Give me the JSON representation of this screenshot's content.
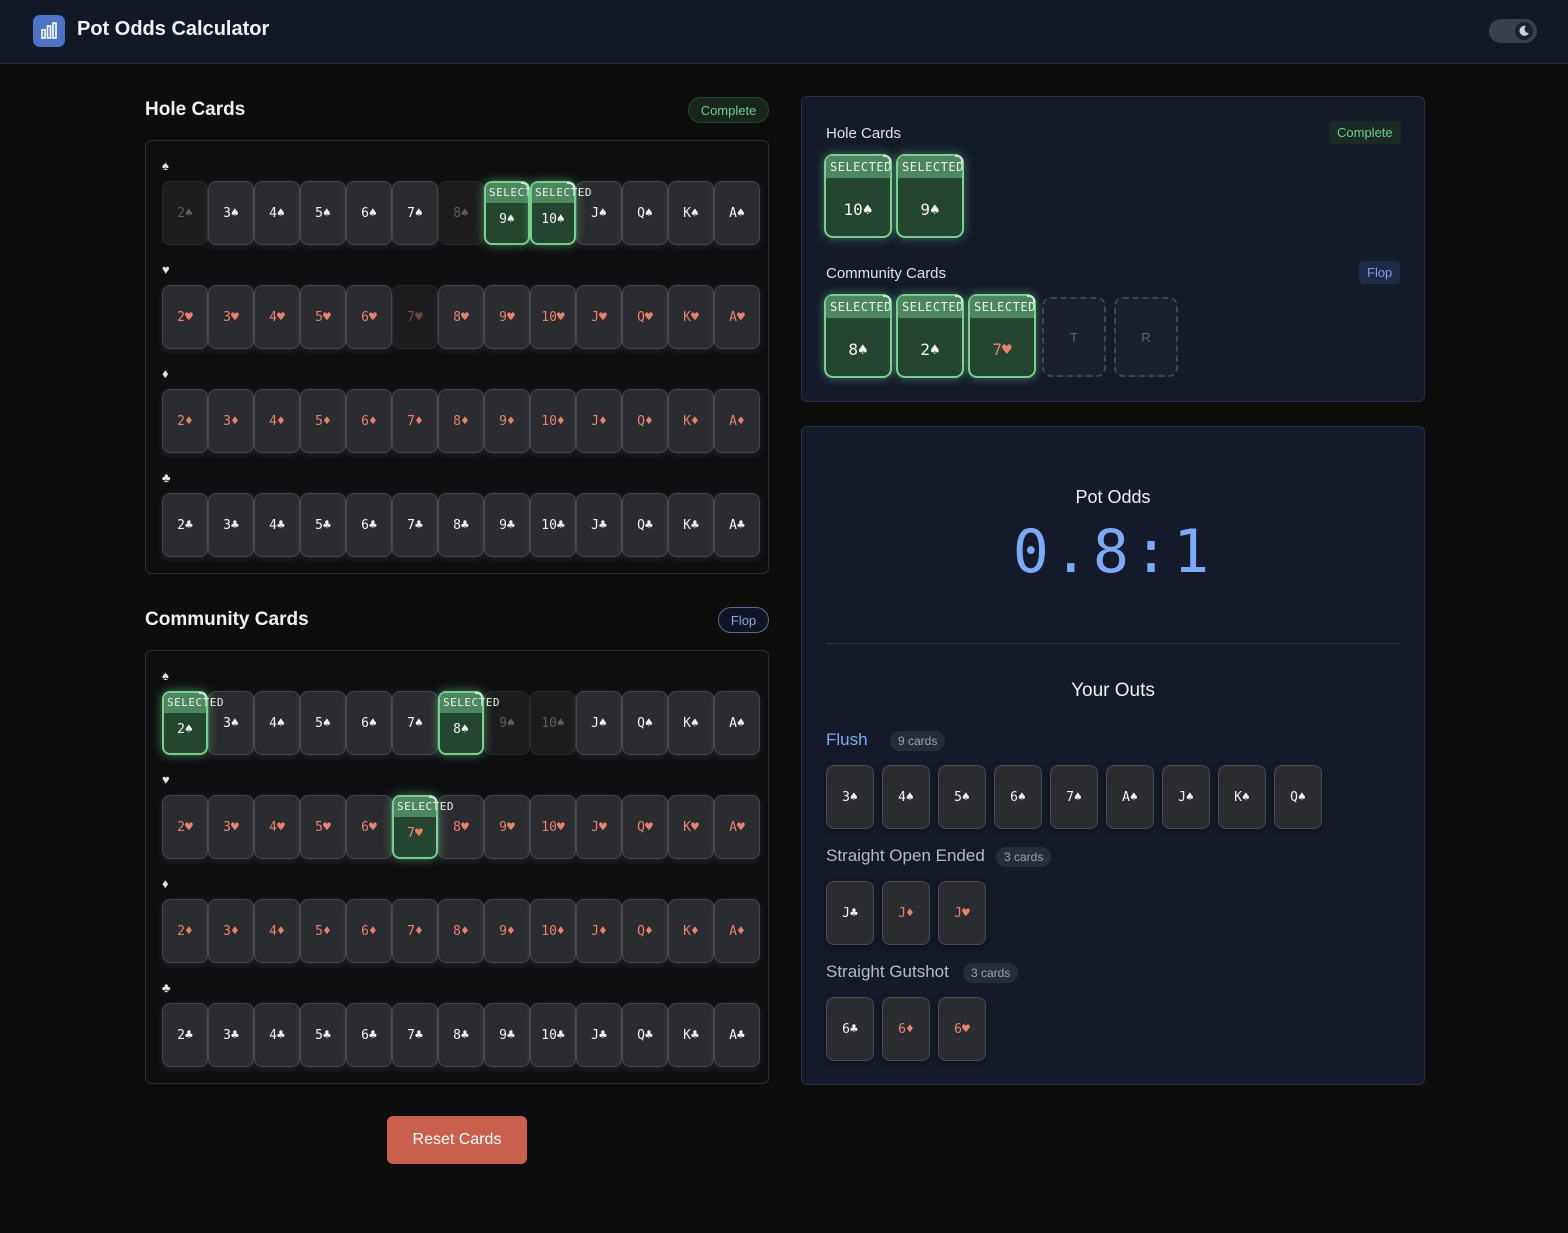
{
  "header": {
    "title": "Pot Odds Calculator",
    "logo_icon": "chart-bar-icon",
    "theme_toggle_icon": "moon-icon"
  },
  "hole_section": {
    "title": "Hole Cards",
    "status": "Complete"
  },
  "community_section": {
    "title": "Community Cards",
    "status": "Flop"
  },
  "selected_tag": "SELECTED",
  "suits": [
    {
      "key": "spades",
      "symbol": "♠",
      "red": false
    },
    {
      "key": "hearts",
      "symbol": "♥",
      "red": true
    },
    {
      "key": "diamonds",
      "symbol": "♦",
      "red": true
    },
    {
      "key": "clubs",
      "symbol": "♣",
      "red": false
    }
  ],
  "ranks": [
    "2",
    "3",
    "4",
    "5",
    "6",
    "7",
    "8",
    "9",
    "10",
    "J",
    "Q",
    "K",
    "A"
  ],
  "hole_grid": {
    "selected": [
      "9♠",
      "10♠"
    ],
    "disabled": [
      "2♠",
      "8♠",
      "7♥"
    ]
  },
  "community_grid": {
    "selected": [
      "2♠",
      "8♠",
      "7♥"
    ],
    "disabled": [
      "9♠",
      "10♠"
    ]
  },
  "summary": {
    "hole_label": "Hole Cards",
    "hole_status": "Complete",
    "hole_cards": [
      "10♠",
      "9♠"
    ],
    "community_label": "Community Cards",
    "community_status": "Flop",
    "community_cards": [
      "8♠",
      "2♠",
      "7♥"
    ],
    "placeholders": [
      "T",
      "R"
    ]
  },
  "odds": {
    "title": "Pot Odds",
    "value": "0.8:1",
    "outs_title": "Your Outs",
    "groups": [
      {
        "name": "Flush",
        "count": "9 cards",
        "cards": [
          "3♠",
          "4♠",
          "5♠",
          "6♠",
          "7♠",
          "A♠",
          "J♠",
          "K♠",
          "Q♠"
        ]
      },
      {
        "name": "Straight Open Ended",
        "count": "3 cards",
        "cards": [
          "J♣",
          "J♦",
          "J♥"
        ]
      },
      {
        "name": "Straight Gutshot",
        "count": "3 cards",
        "cards": [
          "6♣",
          "6♦",
          "6♥"
        ]
      }
    ]
  },
  "reset_label": "Reset Cards",
  "colors": {
    "accent_blue": "#7eaaf5",
    "selected_green": "#79cf8f",
    "red_suit": "#e7826f",
    "reset_button": "#c9604e"
  }
}
